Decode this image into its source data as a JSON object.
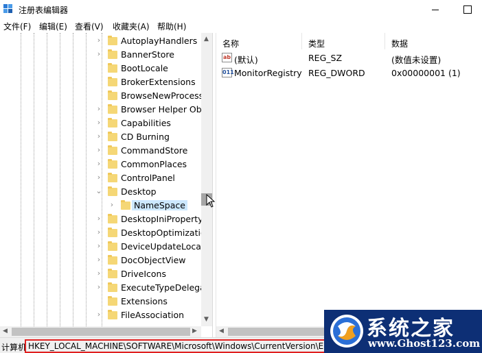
{
  "window": {
    "title": "注册表编辑器",
    "controls": {
      "minimize_icon": "minimize-icon",
      "maximize_icon": "maximize-icon"
    }
  },
  "menu": [
    {
      "label": "文件(F)"
    },
    {
      "label": "编辑(E)"
    },
    {
      "label": "查看(V)"
    },
    {
      "label": "收藏夹(A)"
    },
    {
      "label": "帮助(H)"
    }
  ],
  "tree": {
    "items": [
      {
        "label": "AutoplayHandlers",
        "expander": "›"
      },
      {
        "label": "BannerStore",
        "expander": "›"
      },
      {
        "label": "BootLocale",
        "expander": ""
      },
      {
        "label": "BrokerExtensions",
        "expander": ""
      },
      {
        "label": "BrowseNewProcess",
        "expander": ""
      },
      {
        "label": "Browser Helper Obj",
        "expander": "›"
      },
      {
        "label": "Capabilities",
        "expander": "›"
      },
      {
        "label": "CD Burning",
        "expander": "›"
      },
      {
        "label": "CommandStore",
        "expander": "›"
      },
      {
        "label": "CommonPlaces",
        "expander": "›"
      },
      {
        "label": "ControlPanel",
        "expander": "›"
      },
      {
        "label": "Desktop",
        "expander": "⌄"
      },
      {
        "label": "NameSpace",
        "expander": "›"
      },
      {
        "label": "DesktopIniPropertyI",
        "expander": "›"
      },
      {
        "label": "DesktopOptimizatio",
        "expander": "›"
      },
      {
        "label": "DeviceUpdateLocati",
        "expander": "›"
      },
      {
        "label": "DocObjectView",
        "expander": "›"
      },
      {
        "label": "DriveIcons",
        "expander": "›"
      },
      {
        "label": "ExecuteTypeDelegat",
        "expander": "›"
      },
      {
        "label": "Extensions",
        "expander": ""
      },
      {
        "label": "FileAssociation",
        "expander": "›"
      }
    ],
    "selected": "NameSpace"
  },
  "values": {
    "columns": {
      "name": "名称",
      "type": "类型",
      "data": "数据"
    },
    "rows": [
      {
        "icon": "string-value-icon",
        "icon_text": "ab",
        "name": "(默认)",
        "type": "REG_SZ",
        "data": "(数值未设置)"
      },
      {
        "icon": "dword-value-icon",
        "icon_text": "011",
        "name": "MonitorRegistry",
        "type": "REG_DWORD",
        "data": "0x00000001 (1)"
      }
    ]
  },
  "status": {
    "prefix": "计算机",
    "path": "HKEY_LOCAL_MACHINE\\SOFTWARE\\Microsoft\\Windows\\CurrentVersion\\E"
  },
  "watermark": {
    "title": "系统之家",
    "url": "www.Ghost123.com"
  },
  "colors": {
    "selection": "#cce8ff",
    "folder": "#f5d776",
    "highlight_border": "#e02020",
    "watermark_bg": "#0d2f75"
  }
}
